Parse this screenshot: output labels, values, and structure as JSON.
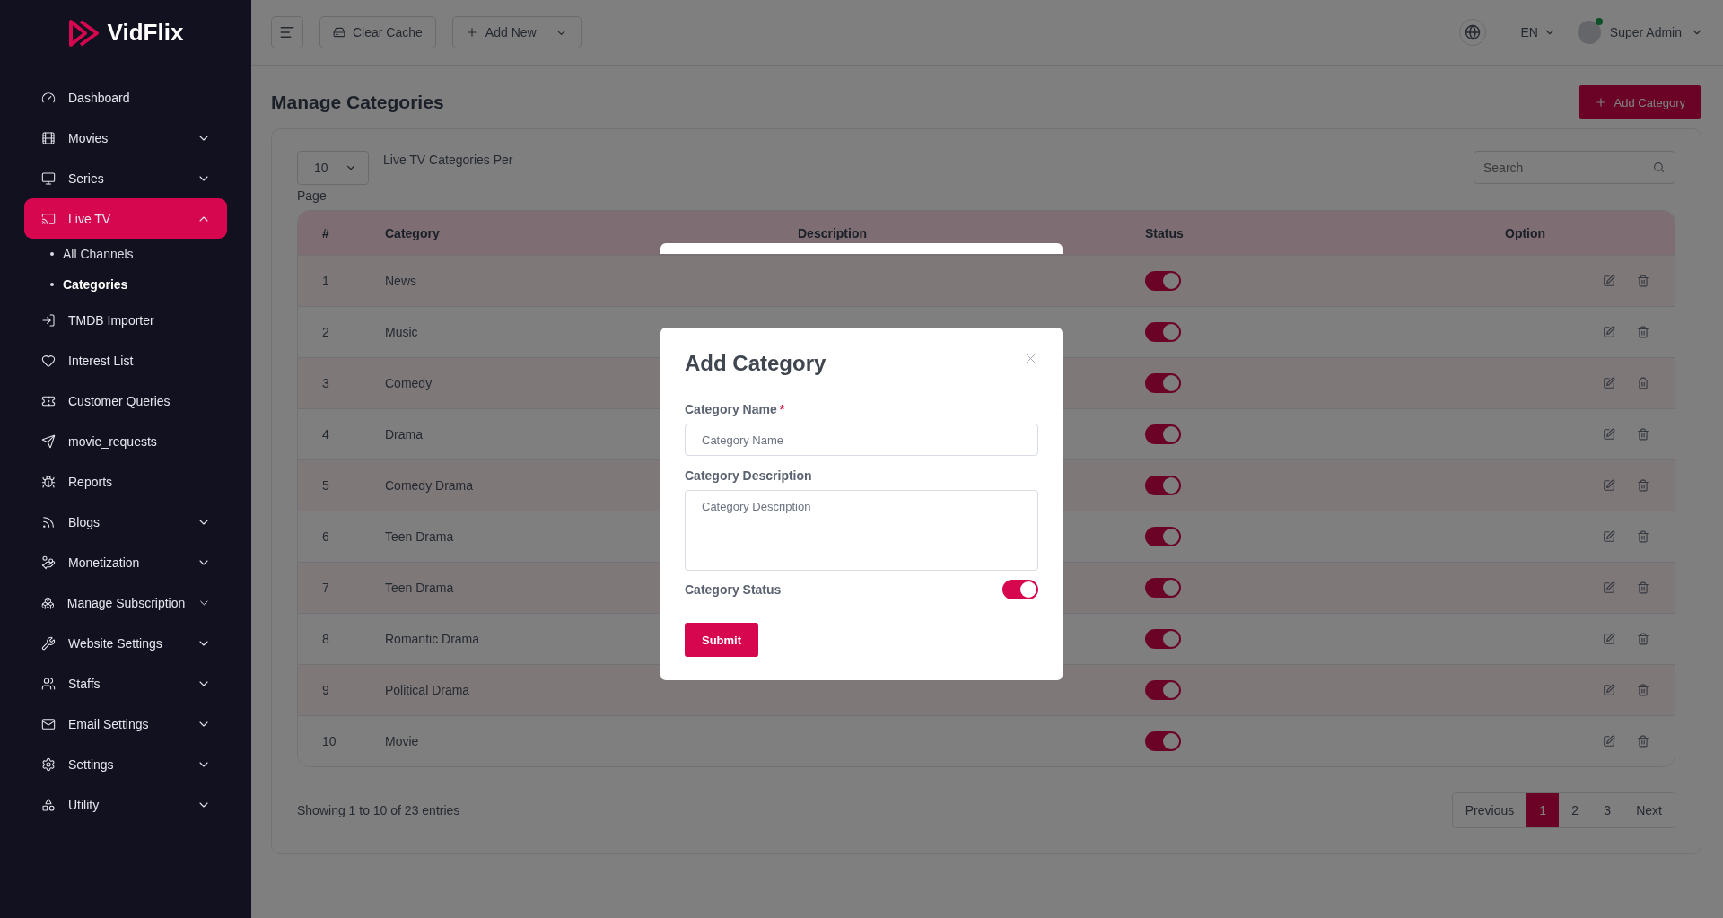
{
  "brand": {
    "name": "VidFlix"
  },
  "sidebar": {
    "items": [
      {
        "label": "Dashboard",
        "kind": "link",
        "selected": false
      },
      {
        "label": "Movies",
        "kind": "group",
        "expanded": false,
        "selected": false
      },
      {
        "label": "Series",
        "kind": "group",
        "expanded": false,
        "selected": false
      },
      {
        "label": "Live TV",
        "kind": "group",
        "expanded": true,
        "selected": true,
        "children": [
          {
            "label": "All Channels",
            "selected": false
          },
          {
            "label": "Categories",
            "selected": true
          }
        ]
      },
      {
        "label": "TMDB Importer",
        "kind": "link",
        "selected": false
      },
      {
        "label": "Interest List",
        "kind": "link",
        "selected": false
      },
      {
        "label": "Customer Queries",
        "kind": "link",
        "selected": false
      },
      {
        "label": "movie_requests",
        "kind": "link",
        "selected": false
      },
      {
        "label": "Reports",
        "kind": "link",
        "selected": false
      },
      {
        "label": "Blogs",
        "kind": "group",
        "expanded": false,
        "selected": false
      },
      {
        "label": "Monetization",
        "kind": "group",
        "expanded": false,
        "selected": false
      },
      {
        "label": "Manage Subscription",
        "kind": "group",
        "expanded": false,
        "selected": false
      },
      {
        "label": "Website Settings",
        "kind": "group",
        "expanded": false,
        "selected": false
      },
      {
        "label": "Staffs",
        "kind": "group",
        "expanded": false,
        "selected": false
      },
      {
        "label": "Email Settings",
        "kind": "group",
        "expanded": false,
        "selected": false
      },
      {
        "label": "Settings",
        "kind": "group",
        "expanded": false,
        "selected": false
      },
      {
        "label": "Utility",
        "kind": "group",
        "expanded": false,
        "selected": false
      }
    ]
  },
  "topbar": {
    "buttons": [
      "Clear Cache",
      "Add New"
    ],
    "language": "EN",
    "user": {
      "name": "Super Admin",
      "online": true
    }
  },
  "page": {
    "title": "Manage Categories",
    "add_button": "Add Category"
  },
  "table_controls": {
    "per_page": "10",
    "per_page_label_lines": [
      "Live TV Categories Per",
      "Page"
    ],
    "search": {
      "placeholder": "Search"
    }
  },
  "table": {
    "columns": [
      "#",
      "Category",
      "Description",
      "Status",
      "Option"
    ],
    "rows": [
      {
        "number": "1",
        "category": "News",
        "active": true
      },
      {
        "number": "2",
        "category": "Music",
        "active": true
      },
      {
        "number": "3",
        "category": "Comedy",
        "active": true
      },
      {
        "number": "4",
        "category": "Drama",
        "active": true
      },
      {
        "number": "5",
        "category": "Comedy Drama",
        "active": true
      },
      {
        "number": "6",
        "category": "Teen Drama",
        "active": true
      },
      {
        "number": "7",
        "category": "Teen Drama",
        "active": true
      },
      {
        "number": "8",
        "category": "Romantic Drama",
        "active": true
      },
      {
        "number": "9",
        "category": "Political Drama",
        "active": true
      },
      {
        "number": "10",
        "category": "Movie",
        "active": true
      }
    ]
  },
  "footer": {
    "summary": "Showing 1 to 10 of 23 entries",
    "pages": [
      {
        "label": "Previous",
        "selected": false
      },
      {
        "label": "1",
        "selected": true
      },
      {
        "label": "2",
        "selected": false
      },
      {
        "label": "3",
        "selected": false
      },
      {
        "label": "Next",
        "selected": false
      }
    ]
  },
  "modal": {
    "title": "Add Category",
    "fields": [
      {
        "kind": "text",
        "label": "Category Name",
        "required_mark": "*",
        "placeholder": "Category Name"
      },
      {
        "kind": "textarea",
        "label": "Category Description",
        "placeholder": "Category Description"
      },
      {
        "kind": "toggle",
        "label": "Category Status",
        "on": true
      }
    ],
    "submit": "Submit"
  }
}
